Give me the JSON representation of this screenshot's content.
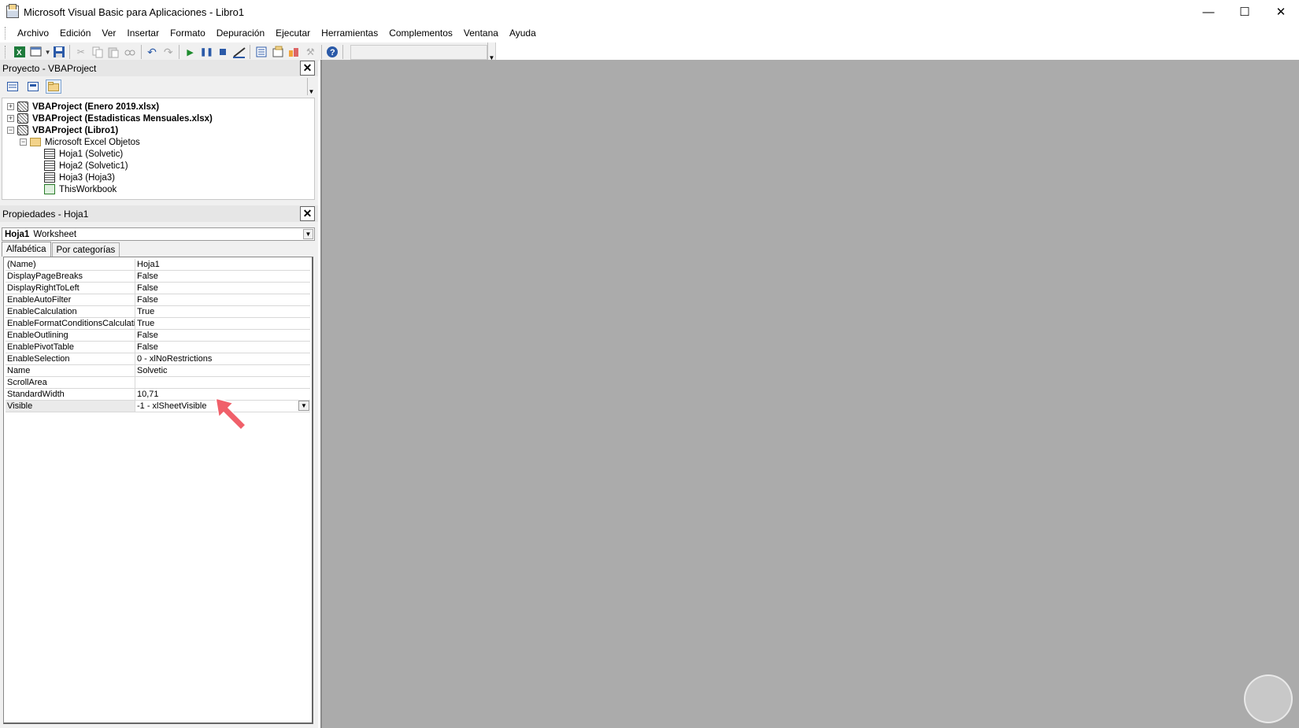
{
  "window": {
    "title": "Microsoft Visual Basic para Aplicaciones - Libro1",
    "icon": "vbe-app-icon",
    "controls": [
      "minimize-icon",
      "maximize-icon",
      "close-icon"
    ]
  },
  "menu": [
    "Archivo",
    "Edición",
    "Ver",
    "Insertar",
    "Formato",
    "Depuración",
    "Ejecutar",
    "Herramientas",
    "Complementos",
    "Ventana",
    "Ayuda"
  ],
  "toolbar": {
    "buttons": [
      "excel-icon",
      "insert-userform-icon",
      "save-icon",
      "cut-icon",
      "copy-icon",
      "paste-icon",
      "find-icon",
      "undo-icon",
      "redo-icon",
      "run-icon",
      "pause-icon",
      "stop-icon",
      "design-mode-icon",
      "project-explorer-icon",
      "properties-icon",
      "object-browser-icon",
      "toolbox-icon",
      "help-icon"
    ]
  },
  "project_panel": {
    "title": "Proyecto - VBAProject",
    "toolbar": [
      "view-code-icon",
      "view-object-icon",
      "toggle-folders-icon"
    ],
    "tree": [
      {
        "label": "VBAProject (Enero 2019.xlsx)",
        "level": 0,
        "expander": "+",
        "icon": "vba-project-icon",
        "bold": true
      },
      {
        "label": "VBAProject (Estadisticas Mensuales.xlsx)",
        "level": 0,
        "expander": "+",
        "icon": "vba-project-icon",
        "bold": true
      },
      {
        "label": "VBAProject (Libro1)",
        "level": 0,
        "expander": "−",
        "icon": "vba-project-icon",
        "bold": true
      },
      {
        "label": "Microsoft Excel Objetos",
        "level": 1,
        "expander": "−",
        "icon": "folder-icon",
        "bold": false
      },
      {
        "label": "Hoja1 (Solvetic)",
        "level": 2,
        "expander": "",
        "icon": "sheet-icon",
        "bold": false
      },
      {
        "label": "Hoja2 (Solvetic1)",
        "level": 2,
        "expander": "",
        "icon": "sheet-icon",
        "bold": false
      },
      {
        "label": "Hoja3 (Hoja3)",
        "level": 2,
        "expander": "",
        "icon": "sheet-icon",
        "bold": false
      },
      {
        "label": "ThisWorkbook",
        "level": 2,
        "expander": "",
        "icon": "workbook-icon",
        "bold": false
      }
    ]
  },
  "properties_panel": {
    "title": "Propiedades - Hoja1",
    "object_name": "Hoja1",
    "object_type": "Worksheet",
    "tabs": [
      "Alfabética",
      "Por categorías"
    ],
    "rows": [
      {
        "name": "(Name)",
        "value": "Hoja1"
      },
      {
        "name": "DisplayPageBreaks",
        "value": "False"
      },
      {
        "name": "DisplayRightToLeft",
        "value": "False"
      },
      {
        "name": "EnableAutoFilter",
        "value": "False"
      },
      {
        "name": "EnableCalculation",
        "value": "True"
      },
      {
        "name": "EnableFormatConditionsCalculation",
        "value": "True"
      },
      {
        "name": "EnableOutlining",
        "value": "False"
      },
      {
        "name": "EnablePivotTable",
        "value": "False"
      },
      {
        "name": "EnableSelection",
        "value": "0 - xlNoRestrictions"
      },
      {
        "name": "Name",
        "value": "Solvetic"
      },
      {
        "name": "ScrollArea",
        "value": ""
      },
      {
        "name": "StandardWidth",
        "value": "10,71"
      },
      {
        "name": "Visible",
        "value": "-1 - xlSheetVisible",
        "selected": true
      }
    ]
  },
  "colors": {
    "workspace": "#ababab",
    "annotation_arrow": "#f0606a"
  }
}
